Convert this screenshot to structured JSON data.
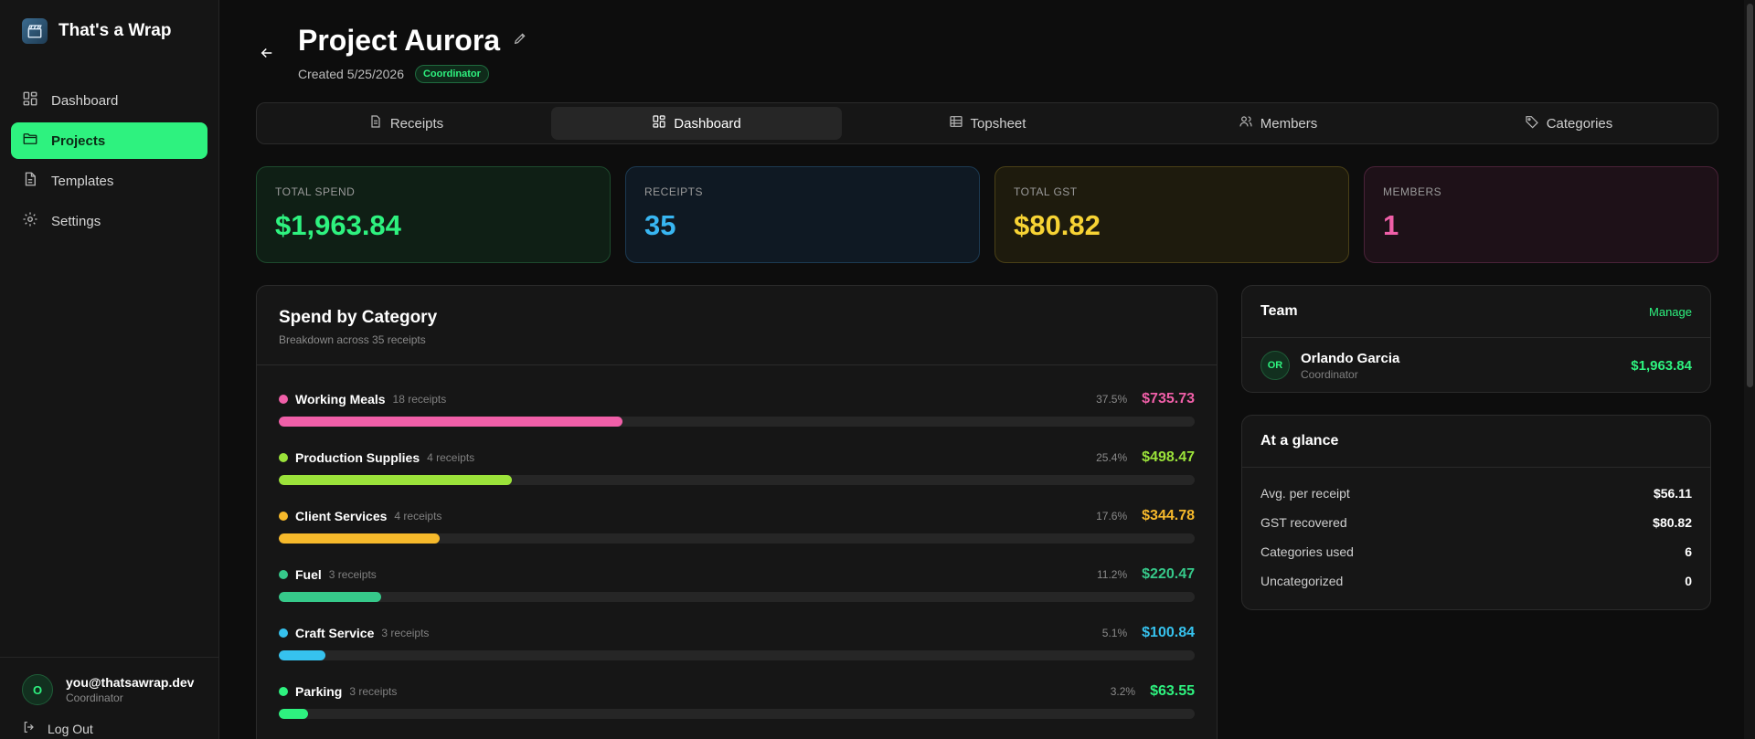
{
  "brand": {
    "name": "That's a Wrap",
    "logo_icon": "clapperboard-icon"
  },
  "sidebar": {
    "items": [
      {
        "label": "Dashboard",
        "icon": "dashboard-icon",
        "active": false
      },
      {
        "label": "Projects",
        "icon": "folder-icon",
        "active": true
      },
      {
        "label": "Templates",
        "icon": "file-icon",
        "active": false
      },
      {
        "label": "Settings",
        "icon": "gear-icon",
        "active": false
      }
    ],
    "user": {
      "initial": "O",
      "email": "you@thatsawrap.dev",
      "role": "Coordinator"
    },
    "logout_label": "Log Out"
  },
  "header": {
    "title": "Project Aurora",
    "created": "Created 5/25/2026",
    "role_badge": "Coordinator"
  },
  "tabs": [
    {
      "label": "Receipts",
      "icon": "receipt-icon",
      "active": false
    },
    {
      "label": "Dashboard",
      "icon": "dashboard-icon",
      "active": true
    },
    {
      "label": "Topsheet",
      "icon": "table-icon",
      "active": false
    },
    {
      "label": "Members",
      "icon": "users-icon",
      "active": false
    },
    {
      "label": "Categories",
      "icon": "tag-icon",
      "active": false
    }
  ],
  "stats": [
    {
      "label": "TOTAL SPEND",
      "value": "$1,963.84",
      "color": "#2ef27f"
    },
    {
      "label": "RECEIPTS",
      "value": "35",
      "color": "#38b6f2"
    },
    {
      "label": "TOTAL GST",
      "value": "$80.82",
      "color": "#f7d334"
    },
    {
      "label": "MEMBERS",
      "value": "1",
      "color": "#f05fa8"
    }
  ],
  "spend": {
    "title": "Spend by Category",
    "subtitle": "Breakdown across 35 receipts",
    "categories": [
      {
        "name": "Working Meals",
        "count": "18 receipts",
        "pct": "37.5%",
        "fraction": 0.375,
        "amount": "$735.73",
        "color": "#f05fa8"
      },
      {
        "name": "Production Supplies",
        "count": "4 receipts",
        "pct": "25.4%",
        "fraction": 0.254,
        "amount": "$498.47",
        "color": "#9be23a"
      },
      {
        "name": "Client Services",
        "count": "4 receipts",
        "pct": "17.6%",
        "fraction": 0.176,
        "amount": "$344.78",
        "color": "#f6b92b"
      },
      {
        "name": "Fuel",
        "count": "3 receipts",
        "pct": "11.2%",
        "fraction": 0.112,
        "amount": "$220.47",
        "color": "#36c98a"
      },
      {
        "name": "Craft Service",
        "count": "3 receipts",
        "pct": "5.1%",
        "fraction": 0.051,
        "amount": "$100.84",
        "color": "#36c2ee"
      },
      {
        "name": "Parking",
        "count": "3 receipts",
        "pct": "3.2%",
        "fraction": 0.032,
        "amount": "$63.55",
        "color": "#2ef27f"
      }
    ]
  },
  "team": {
    "title": "Team",
    "manage_label": "Manage",
    "members": [
      {
        "initials": "OR",
        "name": "Orlando Garcia",
        "role": "Coordinator",
        "amount": "$1,963.84"
      }
    ]
  },
  "glance": {
    "title": "At a glance",
    "rows": [
      {
        "label": "Avg. per receipt",
        "value": "$56.11"
      },
      {
        "label": "GST recovered",
        "value": "$80.82"
      },
      {
        "label": "Categories used",
        "value": "6"
      },
      {
        "label": "Uncategorized",
        "value": "0"
      }
    ]
  }
}
